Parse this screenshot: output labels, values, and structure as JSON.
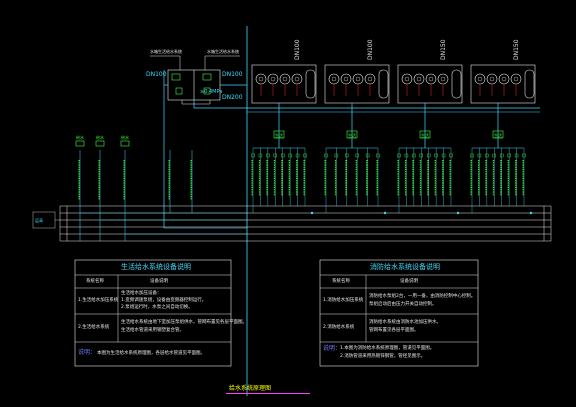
{
  "colors": {
    "background": "#000000",
    "pipe_cyan": "#3fdcff",
    "valve_green": "#3cff3c",
    "text_white": "#e8e8e8",
    "accent_red": "#ff2a2a",
    "title_yellow": "#ffff00",
    "underline_magenta": "#ff3cff",
    "note_blue": "#6f7bff"
  },
  "header_left": {
    "top_label_1": "水箱生活给水系统",
    "top_label_2": "水箱生活给水系统",
    "dn_left": "DN100",
    "dn_right": "DN100",
    "dn_bottom": "DN200",
    "pressure": "≥0.4MPa"
  },
  "pump_groups": [
    {
      "dn": "DN100",
      "manifold": "生活",
      "branch_count": 8
    },
    {
      "dn": "DN100",
      "manifold": "生活",
      "branch_count": 6
    },
    {
      "dn": "DN150",
      "manifold": "生活",
      "branch_count": 8
    },
    {
      "dn": "DN150",
      "manifold": "生活",
      "branch_count": 8
    }
  ],
  "left_valves": [
    "给水",
    "给水",
    "给水"
  ],
  "axis_label": "层高",
  "notes_left": {
    "title": "生活给水系统设备说明",
    "header_col1": "系统名称",
    "header_col2": "设备说明",
    "row1_col1": "1.生活给水加压系统",
    "row1_col2_lines": [
      "生活给水加压设备：",
      "1.变频调速泵组，设备由变频器控制运行。",
      "2.泵组运行时，水泵之间自动切换。"
    ],
    "row2_col1": "2.生活给水系统",
    "row2_col2_lines": [
      "生活给水系统由地下室加压泵组供水，管网布置见各层平面图。",
      "生活给水管道采用钢塑复合管。"
    ],
    "footnote_label": "说明：",
    "footnote_text": "本图为生活给水系统原理图，各层给水管道见平面图。"
  },
  "notes_right": {
    "title": "消防给水系统设备说明",
    "header_col1": "系统名称",
    "header_col2": "设备说明",
    "row1_col1": "1.消防给水加压系统",
    "row1_col2_lines": [
      "消防给水泵组2台，一用一备，由消防控制中心控制。",
      "泵组启动后由压力开关自动控制。"
    ],
    "row2_col1": "2.消防给水系统",
    "row2_col2_lines": [
      "消防给水系统由消防水池加压供水。",
      "管网布置见各层平面图。"
    ],
    "footnote_label": "说明：",
    "footnote_text_lines": [
      "1.本图为消防给水系统原理图，管道见平面图。",
      "2.消防管道采用热镀锌钢管，管径见图示。"
    ]
  },
  "drawing_title": "给水系统原理图"
}
